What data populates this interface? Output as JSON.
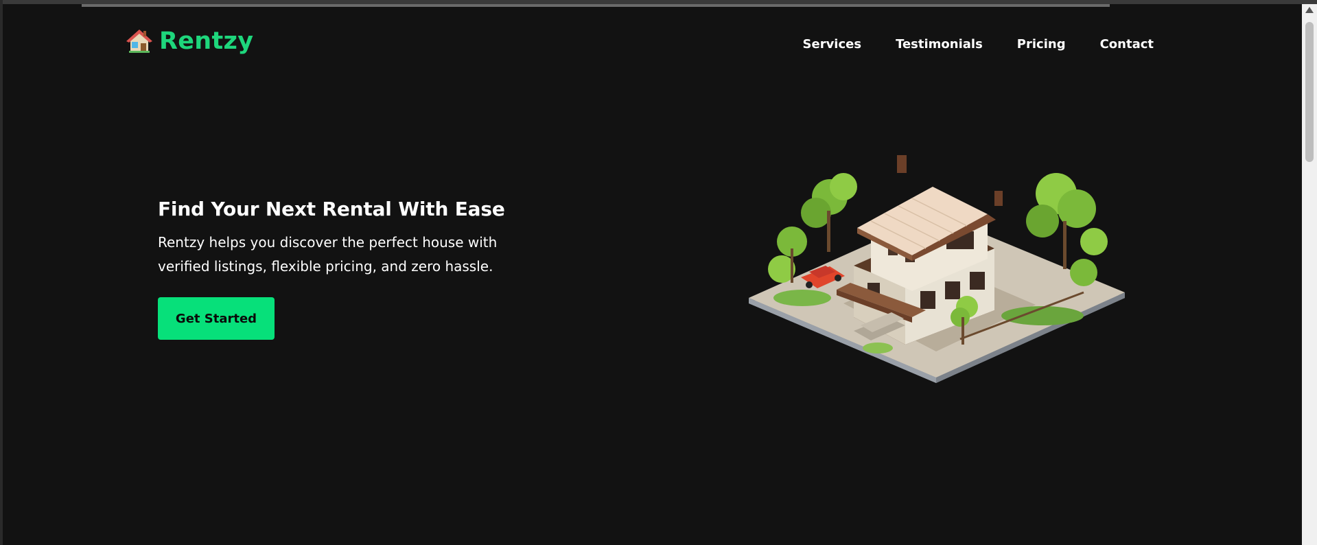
{
  "header": {
    "logo_icon": "house-emoji-icon",
    "brand": "Rentzy",
    "nav": [
      {
        "label": "Services"
      },
      {
        "label": "Testimonials"
      },
      {
        "label": "Pricing"
      },
      {
        "label": "Contact"
      }
    ]
  },
  "hero": {
    "title": "Find Your Next Rental With Ease",
    "subtitle": "Rentzy helps you discover the perfect house with verified listings, flexible pricing, and zero hassle.",
    "cta_label": "Get Started",
    "image_icon": "isometric-house-illustration"
  },
  "colors": {
    "background": "#121212",
    "brand_accent": "#1ed67c",
    "button": "#07e07a",
    "text": "#ffffff"
  }
}
